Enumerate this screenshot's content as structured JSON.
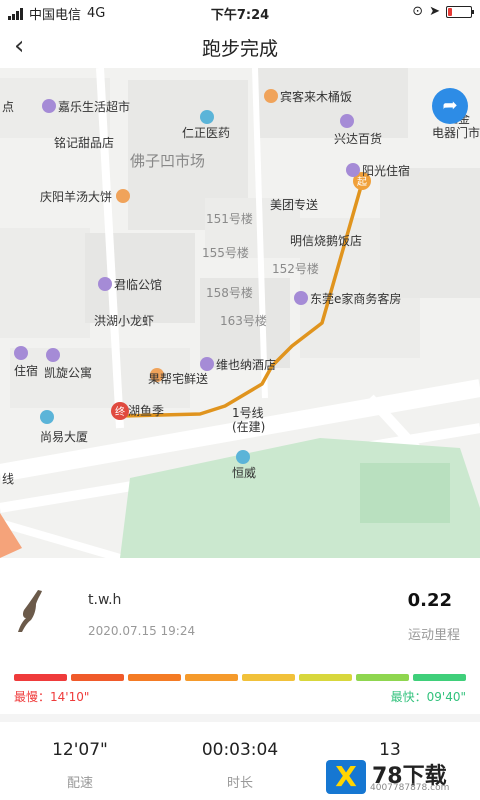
{
  "status_bar": {
    "carrier": "中国电信",
    "network": "4G",
    "time": "下午7:24",
    "battery_level": 0.2
  },
  "nav": {
    "title": "跑步完成",
    "back_icon": "chevron-left-icon"
  },
  "map": {
    "pois": [
      {
        "label": "点",
        "pin": ""
      },
      {
        "label": "嘉乐生活超市",
        "pin": ""
      },
      {
        "label": "铭记甜品店",
        "pin": ""
      },
      {
        "label": "庆阳羊汤大饼",
        "pin": "orange"
      },
      {
        "label": "佛子凹市场",
        "pin": ""
      },
      {
        "label": "仁正医药",
        "pin": "blue"
      },
      {
        "label": "宾客来木桶饭",
        "pin": "orange"
      },
      {
        "label": "兴达百货",
        "pin": "purple"
      },
      {
        "label": "阳光住宿",
        "pin": "purple"
      },
      {
        "label": "美团专送",
        "pin": ""
      },
      {
        "label": "明信烧鹅饭店",
        "pin": ""
      },
      {
        "label": "151号楼",
        "pin": ""
      },
      {
        "label": "155号楼",
        "pin": ""
      },
      {
        "label": "152号楼",
        "pin": ""
      },
      {
        "label": "158号楼",
        "pin": ""
      },
      {
        "label": "163号楼",
        "pin": ""
      },
      {
        "label": "君临公馆",
        "pin": "purple"
      },
      {
        "label": "洪湖小龙虾",
        "pin": ""
      },
      {
        "label": "东莞e家商务客房",
        "pin": "purple"
      },
      {
        "label": "住宿",
        "pin": "purple"
      },
      {
        "label": "凯旋公寓",
        "pin": "purple"
      },
      {
        "label": "果帮宅鲜送",
        "pin": "orange"
      },
      {
        "label": "维也纳酒店",
        "pin": "purple"
      },
      {
        "label": "湖鱼季",
        "pin": ""
      },
      {
        "label": "1号线",
        "pin": ""
      },
      {
        "label": "(在建)",
        "pin": ""
      },
      {
        "label": "尚易大厦",
        "pin": "blue"
      },
      {
        "label": "恒威",
        "pin": "blue"
      },
      {
        "label": "线",
        "pin": ""
      },
      {
        "label": "五金",
        "pin": ""
      },
      {
        "label": "电器门市",
        "pin": ""
      }
    ],
    "start_marker": "终",
    "end_marker": "起",
    "route_color": "#e0941e",
    "navigate_icon": "navigate-arrow-icon"
  },
  "summary": {
    "user_name": "t.w.h",
    "date": "2020.07.15 19:24",
    "distance": "0.22",
    "distance_label": "运动里程",
    "user_icon": "runner-silhouette-icon"
  },
  "pace": {
    "slowest_label": "最慢：",
    "slowest_value": "14'10\"",
    "fastest_label": "最快：",
    "fastest_value": "09'40\"",
    "gradient_colors": [
      "#ef3b3b",
      "#f05a2a",
      "#f47b24",
      "#f59a2b",
      "#f1c13a",
      "#d8d73c",
      "#8fd64f",
      "#3fcf7a"
    ]
  },
  "stats": [
    {
      "value": "12'07\"",
      "label": "配速"
    },
    {
      "value": "00:03:04",
      "label": "时长"
    },
    {
      "value": "13",
      "label": ""
    }
  ],
  "watermark": {
    "logo": "X",
    "name": "78下载",
    "phone": "4007787878.com"
  }
}
